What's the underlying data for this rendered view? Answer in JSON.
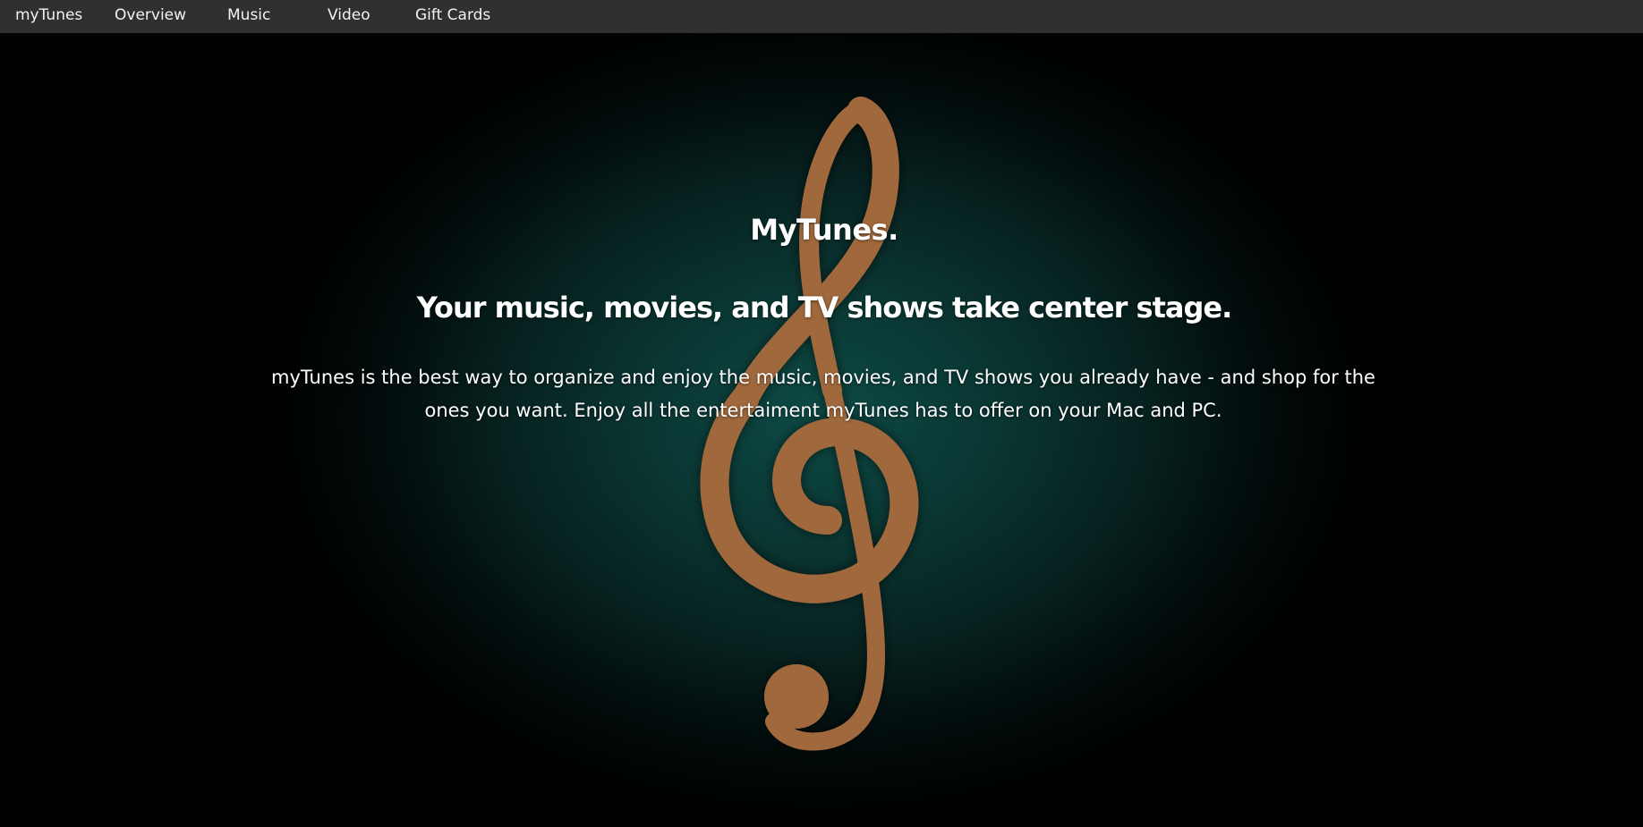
{
  "nav": {
    "brand": "myTunes",
    "items": [
      {
        "label": "Overview"
      },
      {
        "label": "Music"
      },
      {
        "label": "Video"
      },
      {
        "label": "Gift Cards"
      }
    ]
  },
  "hero": {
    "title": "MyTunes.",
    "subtitle": "Your music, movies, and TV shows take center stage.",
    "body": "myTunes is the best way to organize and enjoy the music, movies, and TV shows you already have - and shop for the ones you want. Enjoy all the entertaiment myTunes has to offer on your Mac and PC.",
    "background_image": "treble-clef-icon"
  },
  "colors": {
    "navbar": "#303030",
    "nav_text": "#f2f2f2",
    "hero_glow": "#0d4a45",
    "clef": "#a8693a",
    "text": "#ffffff"
  }
}
